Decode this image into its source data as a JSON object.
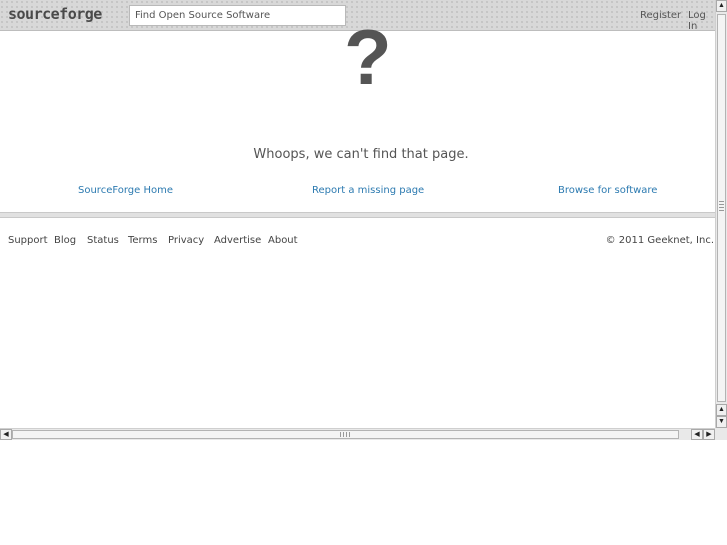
{
  "header": {
    "logo": "sourceforge",
    "search_placeholder": "Find Open Source Software",
    "register": "Register",
    "login": "Log In"
  },
  "error": {
    "symbol": "?",
    "message": "Whoops, we can't find that page."
  },
  "links": {
    "home": "SourceForge Home",
    "report": "Report a missing page",
    "browse": "Browse for software"
  },
  "footer": {
    "items": [
      "Support",
      "Blog",
      "Status",
      "Terms",
      "Privacy",
      "Advertise",
      "About"
    ],
    "copyright": "© 2011 Geeknet, Inc."
  },
  "icons": {
    "up": "arrow-up-icon",
    "down": "arrow-down-icon",
    "left": "arrow-left-icon",
    "right": "arrow-right-icon"
  },
  "colors": {
    "link": "#2c7ab0",
    "text": "#555555",
    "header_bg": "#d8d8d8"
  }
}
